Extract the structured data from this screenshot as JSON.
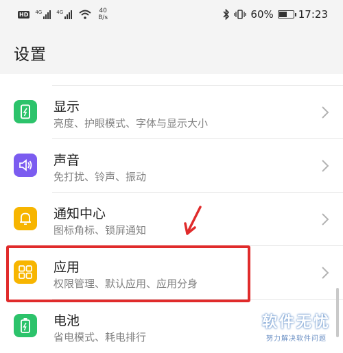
{
  "status_bar": {
    "hd_label": "HD",
    "signal1_label": "4G",
    "signal2_label": "4G",
    "speed_value": "40",
    "speed_unit": "B/s",
    "battery_percent": "60%",
    "battery_level": 0.6,
    "time": "17:23"
  },
  "page": {
    "title": "设置"
  },
  "settings_items": [
    {
      "key": "display",
      "title": "显示",
      "subtitle": "亮度、护眼模式、字体与显示大小",
      "icon": "display-icon",
      "color": "#2cc36b"
    },
    {
      "key": "sound",
      "title": "声音",
      "subtitle": "免打扰、铃声、振动",
      "icon": "speaker-icon",
      "color": "#7b5cf0"
    },
    {
      "key": "notification",
      "title": "通知中心",
      "subtitle": "图标角标、锁屏通知",
      "icon": "bell-icon",
      "color": "#f7b500"
    },
    {
      "key": "apps",
      "title": "应用",
      "subtitle": "权限管理、默认应用、应用分身",
      "icon": "apps-grid-icon",
      "color": "#f7b500"
    },
    {
      "key": "battery",
      "title": "电池",
      "subtitle": "省电模式、耗电排行",
      "icon": "battery-icon",
      "color": "#2cc36b"
    }
  ],
  "annotation": {
    "highlight_color": "#e02b2b"
  },
  "watermark": {
    "title": "软件无忧",
    "subtitle": "努力解决软件问题"
  }
}
